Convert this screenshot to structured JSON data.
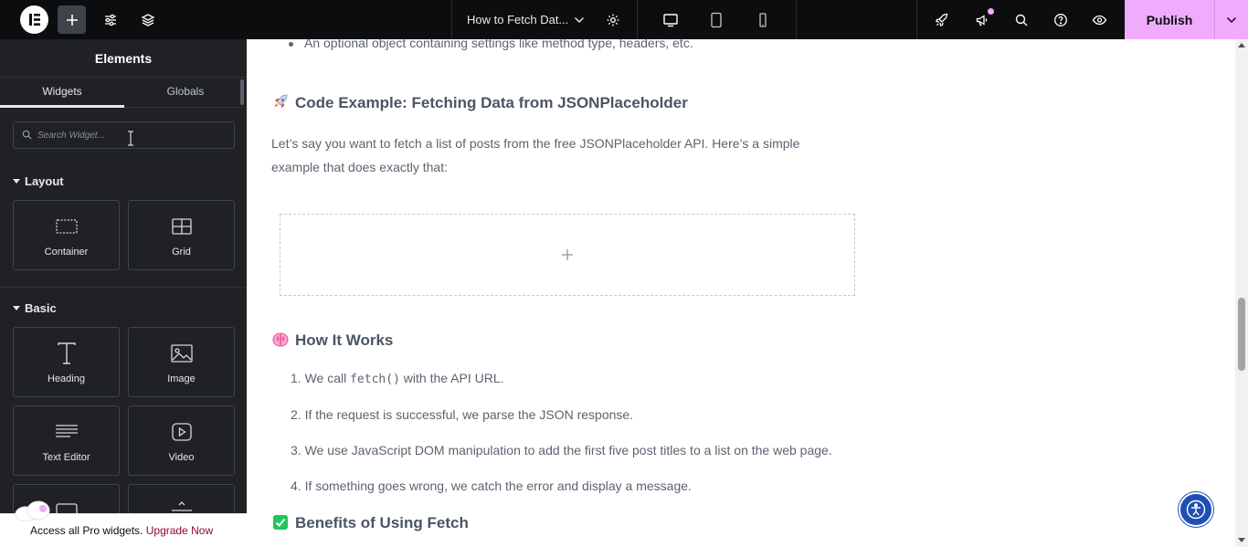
{
  "topbar": {
    "page_title": "How to Fetch Dat...",
    "publish_label": "Publish"
  },
  "panel": {
    "title": "Elements",
    "tabs": [
      "Widgets",
      "Globals"
    ],
    "search_placeholder": "Search Widget...",
    "categories": {
      "layout": "Layout",
      "basic": "Basic"
    },
    "widgets": {
      "container": "Container",
      "grid": "Grid",
      "heading": "Heading",
      "image": "Image",
      "text_editor": "Text Editor",
      "video": "Video"
    },
    "upgrade_text": "Access all Pro widgets.",
    "upgrade_link": "Upgrade Now"
  },
  "content": {
    "bullet": "An optional object containing settings like method type, headers, etc.",
    "heading_code": "Code Example: Fetching Data from JSONPlaceholder",
    "paragraph": "Let’s say you want to fetch a list of posts from the free JSONPlaceholder API. Here’s a simple example that does exactly that:",
    "heading_how": "How It Works",
    "steps": {
      "s1_pre": "1. We call ",
      "s1_code": "fetch()",
      "s1_post": " with the API URL.",
      "s2": "2. If the request is successful, we parse the JSON response.",
      "s3": "3. We use JavaScript DOM manipulation to add the first five post titles to a list on the web page.",
      "s4": "4. If something goes wrong, we catch the error and display a message."
    },
    "heading_benefits": "Benefits of Using Fetch"
  },
  "colors": {
    "topbar": "#0c0d0e",
    "panel": "#1f2124",
    "publish": "#f0abfc",
    "accessibility": "#1f4fb5"
  }
}
